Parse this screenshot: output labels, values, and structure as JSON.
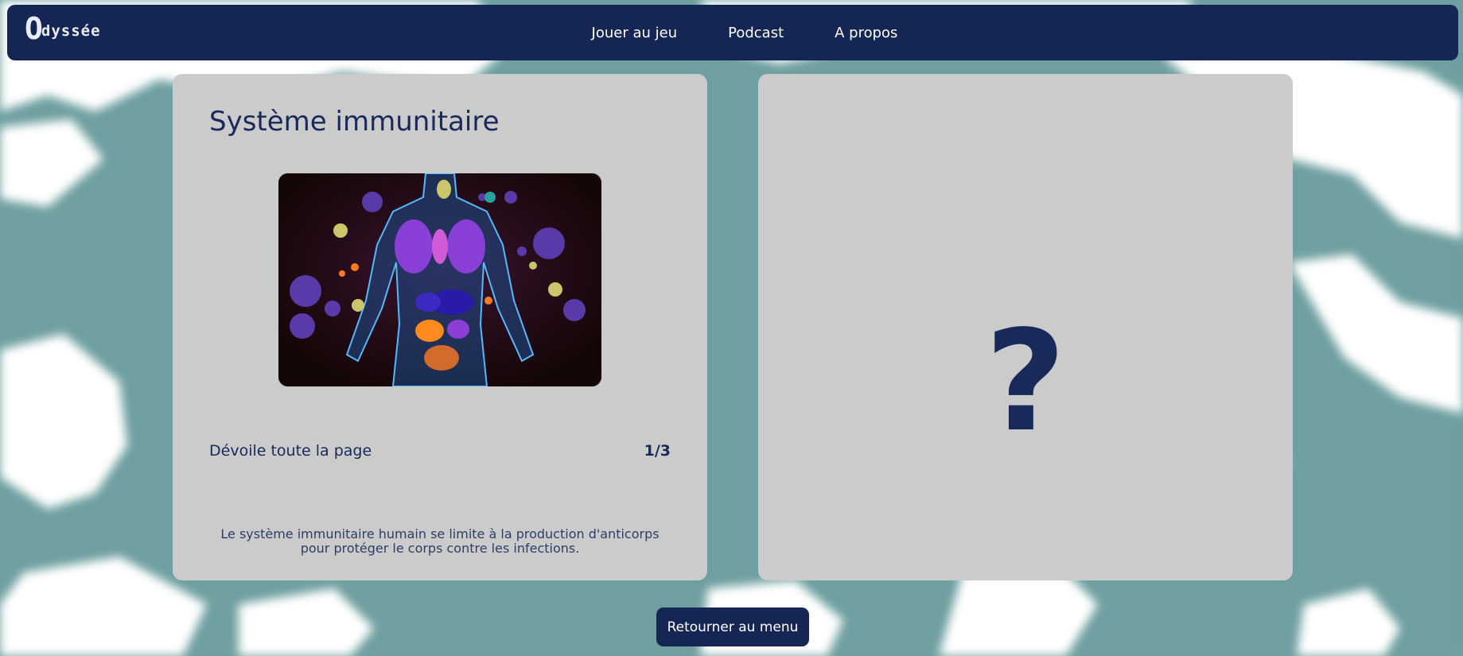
{
  "header": {
    "logo_letter": "O",
    "logo_rest": "dyssée",
    "nav": [
      {
        "label": "Jouer au jeu"
      },
      {
        "label": "Podcast"
      },
      {
        "label": "A propos"
      }
    ]
  },
  "card": {
    "title": "Système immunitaire",
    "reveal_label": "Dévoile toute la page",
    "reveal_count": "1/3",
    "statement_line1": "Le système immunitaire humain se limite à la production d'anticorps",
    "statement_line2": "pour protéger le corps contre les infections."
  },
  "hidden_card": {
    "symbol": "?"
  },
  "footer": {
    "back_label": "Retourner au menu"
  },
  "colors": {
    "navy": "#162654",
    "card": "#cbcbcb",
    "ocean": "#6f9fa0",
    "land": "#ffffff"
  }
}
